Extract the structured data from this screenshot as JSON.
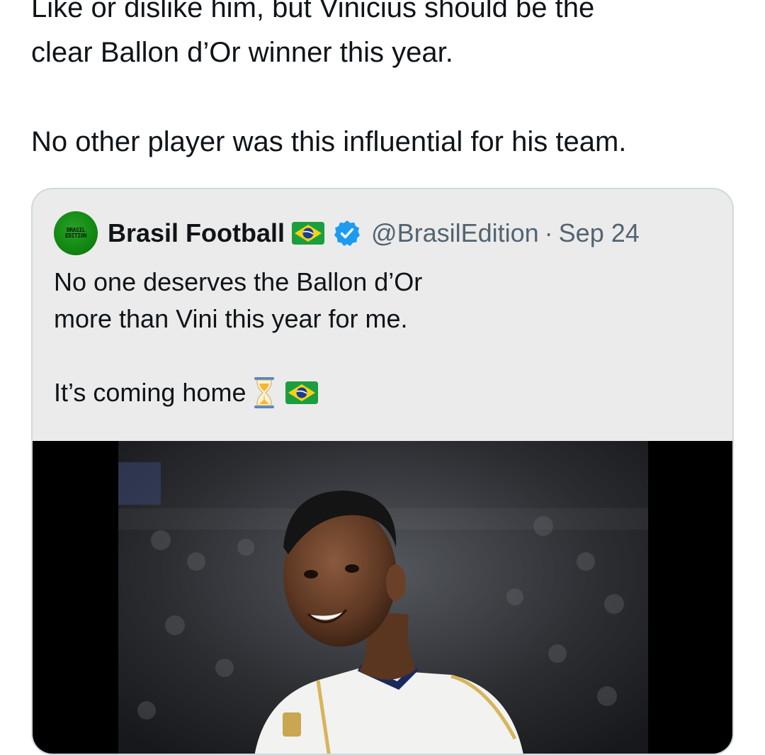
{
  "tweet": {
    "lines": [
      "Like or dislike him, but Vinicius should be the",
      "clear Ballon d’Or winner this year.",
      "No other player was this influential for his team."
    ]
  },
  "quote": {
    "author_name": "Brasil Football",
    "avatar_text": "BRASIL EDITION",
    "handle": "@BrasilEdition",
    "separator": "·",
    "date": "Sep 24",
    "lines": [
      "No one deserves the Ballon d’Or",
      "more than Vini this year for me.",
      "It’s coming home"
    ],
    "emojis": [
      "hourglass-icon",
      "brazil-flag-icon"
    ],
    "media": {
      "type": "photo",
      "subject": "football player in white kit in front of stadium crowd"
    }
  },
  "colors": {
    "text": "#0f1419",
    "secondary_text": "#536471",
    "verified_blue": "#1d9bf0",
    "card_background": "#ebebeb",
    "card_border": "#cfd9de",
    "flag_green": "#1b9e3e",
    "flag_yellow": "#f7d117",
    "flag_blue": "#1b3c8f"
  }
}
